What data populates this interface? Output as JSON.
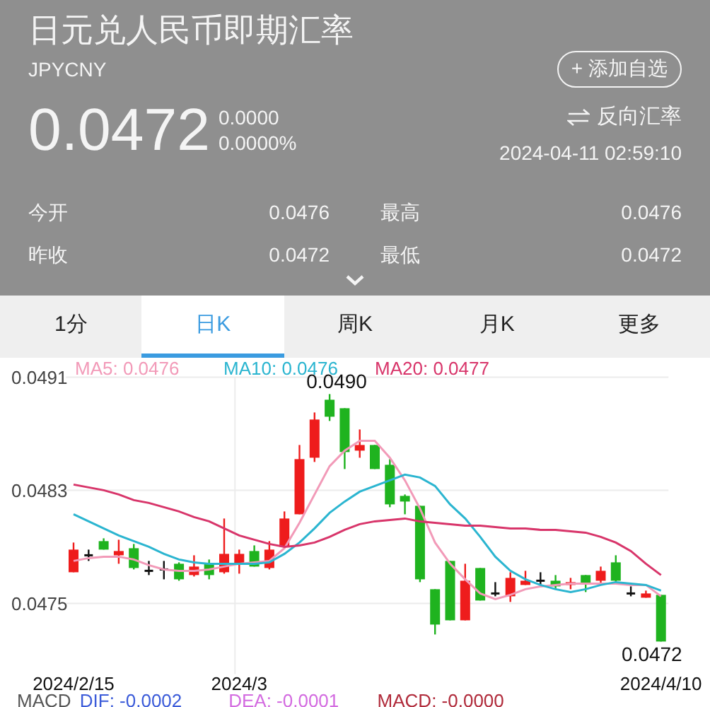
{
  "header": {
    "title": "日元兑人民币即期汇率",
    "symbol": "JPYCNY",
    "add_button": "+ 添加自选",
    "price": "0.0472",
    "change": "0.0000",
    "change_percent": "0.0000%",
    "reverse_button": "反向汇率",
    "timestamp": "2024-04-11 02:59:10",
    "stats": [
      {
        "label": "今开",
        "value": "0.0476"
      },
      {
        "label": "最高",
        "value": "0.0476"
      },
      {
        "label": "昨收",
        "value": "0.0472"
      },
      {
        "label": "最低",
        "value": "0.0472"
      }
    ]
  },
  "tabs": [
    {
      "label": "1分",
      "selected": false
    },
    {
      "label": "日K",
      "selected": true
    },
    {
      "label": "周K",
      "selected": false
    },
    {
      "label": "月K",
      "selected": false
    },
    {
      "label": "更多",
      "selected": false
    }
  ],
  "chart": {
    "legend": [
      {
        "reading": ": 0.0476"
      },
      {
        "reading": ": 0.0476"
      },
      {
        "reading": ": 0.0477"
      }
    ],
    "chart_data": {
      "type": "candlestick",
      "grid": true,
      "ylim": [
        0.047,
        0.0491
      ],
      "yticks": [
        0.0475,
        0.0483,
        0.0491
      ],
      "categories": [
        "2024/2/15",
        null,
        null,
        null,
        null,
        null,
        null,
        null,
        null,
        null,
        null,
        "2024/3",
        null,
        null,
        null,
        null,
        null,
        null,
        null,
        null,
        null,
        null,
        null,
        null,
        null,
        null,
        null,
        null,
        null,
        null,
        null,
        null,
        null,
        null,
        null,
        null,
        null,
        null,
        null,
        "2024/4/10"
      ],
      "annotations": [
        "0.0490",
        "0.0472"
      ],
      "series": [
        {
          "name": "MA5",
          "type": "line",
          "color": "#f29ab8",
          "values": [
            0.0478,
            0.04782,
            0.04783,
            0.04783,
            0.04781,
            0.04777,
            0.04774,
            0.04773,
            0.04773,
            0.04774,
            0.04776,
            0.04778,
            0.04779,
            0.0478,
            0.04789,
            0.04807,
            0.04827,
            0.04847,
            0.04858,
            0.04865,
            0.04865,
            0.04853,
            0.04837,
            0.04817,
            0.04793,
            0.04778,
            0.04767,
            0.04757,
            0.04753,
            0.04756,
            0.0476,
            0.04762,
            0.04763,
            0.04764,
            0.04764,
            0.04764,
            0.04764,
            0.04763,
            0.04763,
            0.04755
          ]
        },
        {
          "name": "MA10",
          "type": "line",
          "color": "#2bb5d0",
          "values": [
            0.04813,
            0.04808,
            0.04803,
            0.04798,
            0.04794,
            0.0479,
            0.04785,
            0.04781,
            0.04779,
            0.04778,
            0.04778,
            0.04778,
            0.04778,
            0.04779,
            0.04785,
            0.04793,
            0.04803,
            0.04814,
            0.04822,
            0.04829,
            0.04833,
            0.04837,
            0.04841,
            0.04839,
            0.04833,
            0.0482,
            0.0481,
            0.04797,
            0.04783,
            0.04773,
            0.04767,
            0.04763,
            0.0476,
            0.04758,
            0.0476,
            0.04763,
            0.04765,
            0.04764,
            0.04763,
            0.04759
          ]
        },
        {
          "name": "MA20",
          "type": "line",
          "color": "#d8356a",
          "values": [
            0.04834,
            0.04832,
            0.0483,
            0.04827,
            0.04823,
            0.04821,
            0.04818,
            0.04815,
            0.04811,
            0.04808,
            0.04803,
            0.04798,
            0.04795,
            0.04792,
            0.0479,
            0.04791,
            0.04793,
            0.04797,
            0.04802,
            0.04806,
            0.04808,
            0.04809,
            0.0481,
            0.04808,
            0.04807,
            0.04806,
            0.04805,
            0.04805,
            0.04804,
            0.04803,
            0.04803,
            0.04802,
            0.04802,
            0.04801,
            0.048,
            0.04797,
            0.04793,
            0.04787,
            0.04778,
            0.0477
          ]
        }
      ],
      "ohlc": [
        [
          0.04772,
          0.04793,
          0.04772,
          0.04788
        ],
        [
          0.04784,
          0.04788,
          0.0478,
          0.04784
        ],
        [
          0.04794,
          0.04796,
          0.04788,
          0.04788
        ],
        [
          0.04784,
          0.04795,
          0.04778,
          0.04787
        ],
        [
          0.04789,
          0.04792,
          0.04774,
          0.04775
        ],
        [
          0.04773,
          0.0478,
          0.0477,
          0.04773
        ],
        [
          0.04774,
          0.0478,
          0.04767,
          0.04774
        ],
        [
          0.04778,
          0.04779,
          0.04766,
          0.04767
        ],
        [
          0.0477,
          0.04784,
          0.04769,
          0.04776
        ],
        [
          0.04778,
          0.04781,
          0.04767,
          0.0477
        ],
        [
          0.04772,
          0.0481,
          0.04771,
          0.04785
        ],
        [
          0.04778,
          0.04788,
          0.04771,
          0.04785
        ],
        [
          0.04787,
          0.04791,
          0.04776,
          0.04776
        ],
        [
          0.04775,
          0.04794,
          0.04774,
          0.04788
        ],
        [
          0.0479,
          0.04815,
          0.04789,
          0.0481
        ],
        [
          0.04813,
          0.04862,
          0.04813,
          0.04852
        ],
        [
          0.04853,
          0.04885,
          0.0485,
          0.0488
        ],
        [
          0.04894,
          0.04898,
          0.04879,
          0.04882
        ],
        [
          0.04888,
          0.04888,
          0.04845,
          0.04857
        ],
        [
          0.04858,
          0.04873,
          0.04853,
          0.04862
        ],
        [
          0.04862,
          0.04862,
          0.04845,
          0.04845
        ],
        [
          0.04848,
          0.04852,
          0.04818,
          0.0482
        ],
        [
          0.04826,
          0.04827,
          0.04813,
          0.04822
        ],
        [
          0.04819,
          0.04819,
          0.04765,
          0.04767
        ],
        [
          0.0476,
          0.0476,
          0.04728,
          0.04735
        ],
        [
          0.0478,
          0.0478,
          0.04738,
          0.04738
        ],
        [
          0.04738,
          0.04778,
          0.04738,
          0.04766
        ],
        [
          0.04775,
          0.04775,
          0.04752,
          0.04752
        ],
        [
          0.04757,
          0.04765,
          0.04755,
          0.04757
        ],
        [
          0.04755,
          0.04772,
          0.04751,
          0.04768
        ],
        [
          0.04763,
          0.04773,
          0.04763,
          0.04766
        ],
        [
          0.04766,
          0.04772,
          0.04763,
          0.04766
        ],
        [
          0.04766,
          0.0477,
          0.0476,
          0.04762
        ],
        [
          0.04763,
          0.04768,
          0.0476,
          0.04765
        ],
        [
          0.0477,
          0.0477,
          0.04758,
          0.04764
        ],
        [
          0.04766,
          0.04776,
          0.04764,
          0.04773
        ],
        [
          0.04779,
          0.04784,
          0.04764,
          0.04766
        ],
        [
          0.04757,
          0.04762,
          0.04755,
          0.04757
        ],
        [
          0.04754,
          0.04759,
          0.04754,
          0.04757
        ],
        [
          0.04756,
          0.04756,
          0.04723,
          0.04723
        ]
      ]
    },
    "macd": [
      {
        "label": "MACD",
        "color": "#555555"
      },
      {
        "label": "DIF: -0.0002",
        "color": "#3b5bd9"
      },
      {
        "label": "DEA: -0.0001",
        "color": "#d36be0"
      },
      {
        "label": "MACD: -0.0000",
        "color": "#b02a3a"
      }
    ]
  }
}
